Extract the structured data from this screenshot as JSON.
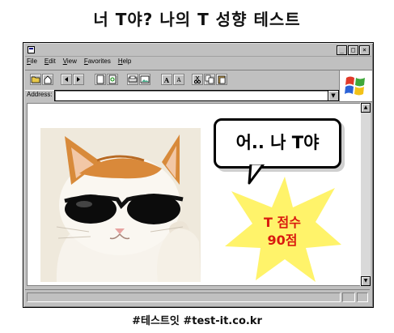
{
  "page_title": "너 T야? 나의 T 성향 테스트",
  "window": {
    "menu": [
      "File",
      "Edit",
      "View",
      "Favorites",
      "Help"
    ],
    "title_buttons": [
      "_",
      "□",
      "×"
    ],
    "toolbar_icons": [
      "open-folder-icon",
      "home-icon",
      "back-icon",
      "forward-icon",
      "page-icon",
      "refresh-icon",
      "print-icon",
      "image-icon",
      "font-larger-icon",
      "font-smaller-icon",
      "cut-icon",
      "copy-icon",
      "paste-icon"
    ],
    "address_label": "Address:",
    "address_value": ""
  },
  "content": {
    "speech_bubble": "어.. 나 T야",
    "score_label": "T 점수",
    "score_value": "90점",
    "colors": {
      "star": "#fff36a",
      "score_text": "#d9190f"
    }
  },
  "footer": "#테스트잇 #test-it.co.kr"
}
